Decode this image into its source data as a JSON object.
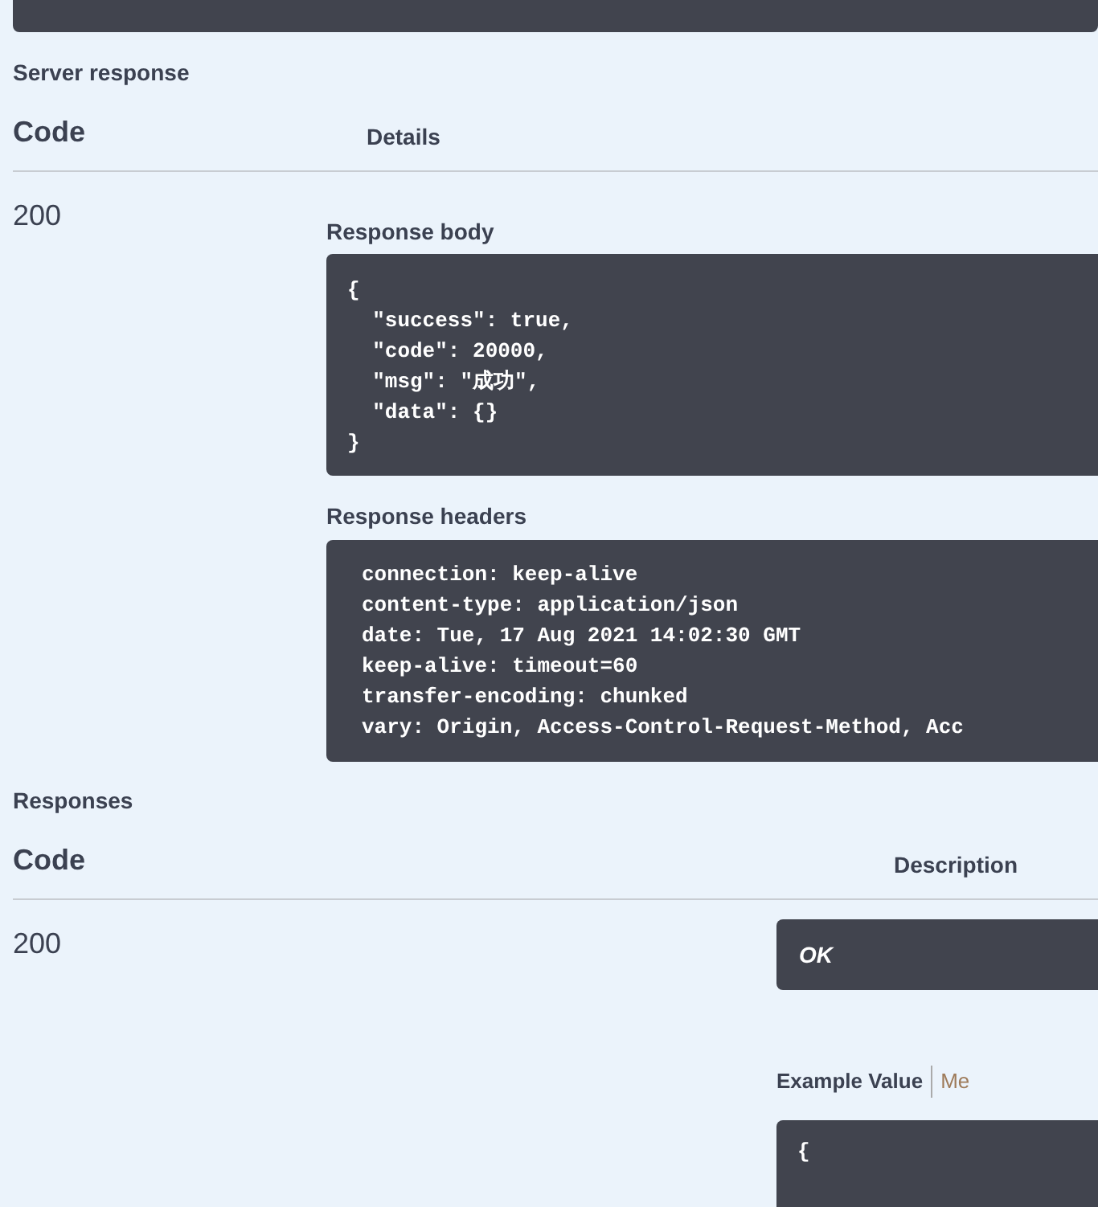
{
  "server_response": {
    "title": "Server response",
    "columns": [
      "Code",
      "Details"
    ],
    "rows": [
      {
        "code": "200",
        "body_label": "Response body",
        "body_lines": [
          "{",
          "  \"success\": true,",
          "  \"code\": 20000,",
          "  \"msg\": \"成功\",",
          "  \"data\": {}",
          "}"
        ],
        "headers_label": "Response headers",
        "headers_lines": [
          "connection: keep-alive",
          "content-type: application/json",
          "date: Tue, 17 Aug 2021 14:02:30 GMT",
          "keep-alive: timeout=60",
          "transfer-encoding: chunked",
          "vary: Origin, Access-Control-Request-Method, Acc"
        ]
      }
    ]
  },
  "responses": {
    "title": "Responses",
    "columns": [
      "Code",
      "Description"
    ],
    "rows": [
      {
        "code": "200",
        "description": "OK",
        "tabs": [
          {
            "label": "Example Value",
            "selected": true
          },
          {
            "label": "Me",
            "selected": false
          }
        ],
        "example_lines": [
          "{"
        ]
      }
    ]
  }
}
